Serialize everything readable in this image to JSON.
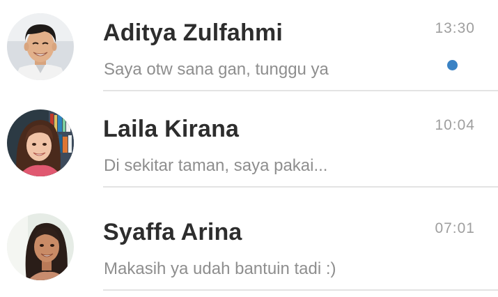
{
  "chats": [
    {
      "name": "Aditya Zulfahmi",
      "message": "Saya otw sana gan, tunggu ya",
      "time": "13:30",
      "unread": true,
      "avatar": "male-avatar-photo"
    },
    {
      "name": "Laila Kirana",
      "message": "Di sekitar taman, saya pakai...",
      "time": "10:04",
      "unread": false,
      "avatar": "female-avatar-photo"
    },
    {
      "name": "Syaffa Arina",
      "message": "Makasih ya udah bantuin tadi :)",
      "time": "07:01",
      "unread": false,
      "avatar": "female-avatar-photo"
    }
  ],
  "colors": {
    "unread_dot": "#3a82c4",
    "name_text": "#2d2d2d",
    "message_text": "#8e8e8e",
    "time_text": "#9e9e9e",
    "divider": "#e3e3e3"
  }
}
